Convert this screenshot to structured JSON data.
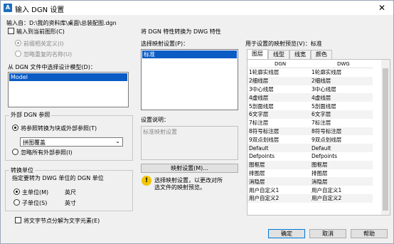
{
  "window": {
    "title": "输入 DGN 设置",
    "close_glyph": "✕"
  },
  "import_from": "输入自：D:\\我的资料库\\桌面\\总装配图.dgn",
  "import_to_current": "输入到当前图形(C)",
  "prefix_names": "前缀相关定义(I)",
  "ignore_duplicates": "忽略重复的名称(U)",
  "select_model_label": "从 DGN 文件中选择设计模型(D)：",
  "models": [
    "Model"
  ],
  "xref_group": {
    "title": "外部 DGN 参照",
    "convert_label": "将参照转换为块或外部参照(T)",
    "dropdown_value": "拼图覆盖",
    "ignore_label": "忽略所有外部参照(I)"
  },
  "units_group": {
    "title": "转换单位",
    "subtitle": "指定要转为 DWG 单位的 DGN 单位",
    "master_label": "主单位(M)",
    "master_value": "英尺",
    "sub_label": "子单位(S)",
    "sub_value": "英寸"
  },
  "explode_text": "将文字节点分解为文字元素(E)",
  "right_title": "将 DGN 特性转换为 DWG 特性",
  "mapping_select_label": "选择映射设置(P)：",
  "mapping_items": [
    "标准"
  ],
  "desc_label": "设置说明：",
  "desc_value": "标准映射设置",
  "mapping_button": "映射设置(M)...",
  "warning_text_1": "选择映射设置，以更改对所",
  "warning_text_2": "选文件的映射预览。",
  "preview_label": "用于设置的映射预览(V)：标准",
  "tabs": [
    "图层",
    "线型",
    "线宽",
    "颜色"
  ],
  "table_headers": [
    "DGN",
    "DWG"
  ],
  "table_rows": [
    [
      "1轮廓实线层",
      "1轮廓实线层"
    ],
    [
      "2细线层",
      "2细线层"
    ],
    [
      "3中心线层",
      "3中心线层"
    ],
    [
      "4虚线层",
      "4虚线层"
    ],
    [
      "5剖面线层",
      "5剖面线层"
    ],
    [
      "6文字层",
      "6文字层"
    ],
    [
      "7标注层",
      "7标注层"
    ],
    [
      "8符号标注层",
      "8符号标注层"
    ],
    [
      "9双点划线层",
      "9双点划线层"
    ],
    [
      "Default",
      "Default"
    ],
    [
      "Defpoints",
      "Defpoints"
    ],
    [
      "图框层",
      "图框层"
    ],
    [
      "排图层",
      "排图层"
    ],
    [
      "消隐层",
      "消隐层"
    ],
    [
      "用户自定义1",
      "用户自定义1"
    ],
    [
      "用户自定义2",
      "用户自定义2"
    ]
  ],
  "buttons": {
    "ok": "确定",
    "cancel": "取消",
    "help": "帮助"
  }
}
